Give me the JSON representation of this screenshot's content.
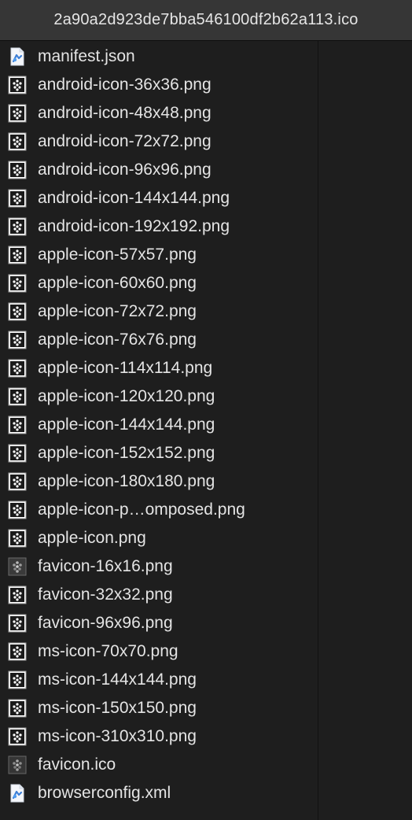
{
  "window": {
    "title": "2a90a2d923de7bba546100df2b62a113.ico"
  },
  "files": [
    {
      "name": "manifest.json",
      "icon": "json-file-icon"
    },
    {
      "name": "android-icon-36x36.png",
      "icon": "png-file-icon"
    },
    {
      "name": "android-icon-48x48.png",
      "icon": "png-file-icon"
    },
    {
      "name": "android-icon-72x72.png",
      "icon": "png-file-icon"
    },
    {
      "name": "android-icon-96x96.png",
      "icon": "png-file-icon"
    },
    {
      "name": "android-icon-144x144.png",
      "icon": "png-file-icon"
    },
    {
      "name": "android-icon-192x192.png",
      "icon": "png-file-icon"
    },
    {
      "name": "apple-icon-57x57.png",
      "icon": "png-file-icon"
    },
    {
      "name": "apple-icon-60x60.png",
      "icon": "png-file-icon"
    },
    {
      "name": "apple-icon-72x72.png",
      "icon": "png-file-icon"
    },
    {
      "name": "apple-icon-76x76.png",
      "icon": "png-file-icon"
    },
    {
      "name": "apple-icon-114x114.png",
      "icon": "png-file-icon"
    },
    {
      "name": "apple-icon-120x120.png",
      "icon": "png-file-icon"
    },
    {
      "name": "apple-icon-144x144.png",
      "icon": "png-file-icon"
    },
    {
      "name": "apple-icon-152x152.png",
      "icon": "png-file-icon"
    },
    {
      "name": "apple-icon-180x180.png",
      "icon": "png-file-icon"
    },
    {
      "name": "apple-icon-p…omposed.png",
      "icon": "png-file-icon"
    },
    {
      "name": "apple-icon.png",
      "icon": "png-file-icon"
    },
    {
      "name": "favicon-16x16.png",
      "icon": "png-thumbnail-icon"
    },
    {
      "name": "favicon-32x32.png",
      "icon": "png-file-icon"
    },
    {
      "name": "favicon-96x96.png",
      "icon": "png-file-icon"
    },
    {
      "name": "ms-icon-70x70.png",
      "icon": "png-file-icon"
    },
    {
      "name": "ms-icon-144x144.png",
      "icon": "png-file-icon"
    },
    {
      "name": "ms-icon-150x150.png",
      "icon": "png-file-icon"
    },
    {
      "name": "ms-icon-310x310.png",
      "icon": "png-file-icon"
    },
    {
      "name": "favicon.ico",
      "icon": "ico-thumbnail-icon"
    },
    {
      "name": "browserconfig.xml",
      "icon": "xml-file-icon"
    }
  ],
  "colors": {
    "background": "#1e1e1e",
    "titlebar": "#363636",
    "text": "#e4e4e4"
  }
}
